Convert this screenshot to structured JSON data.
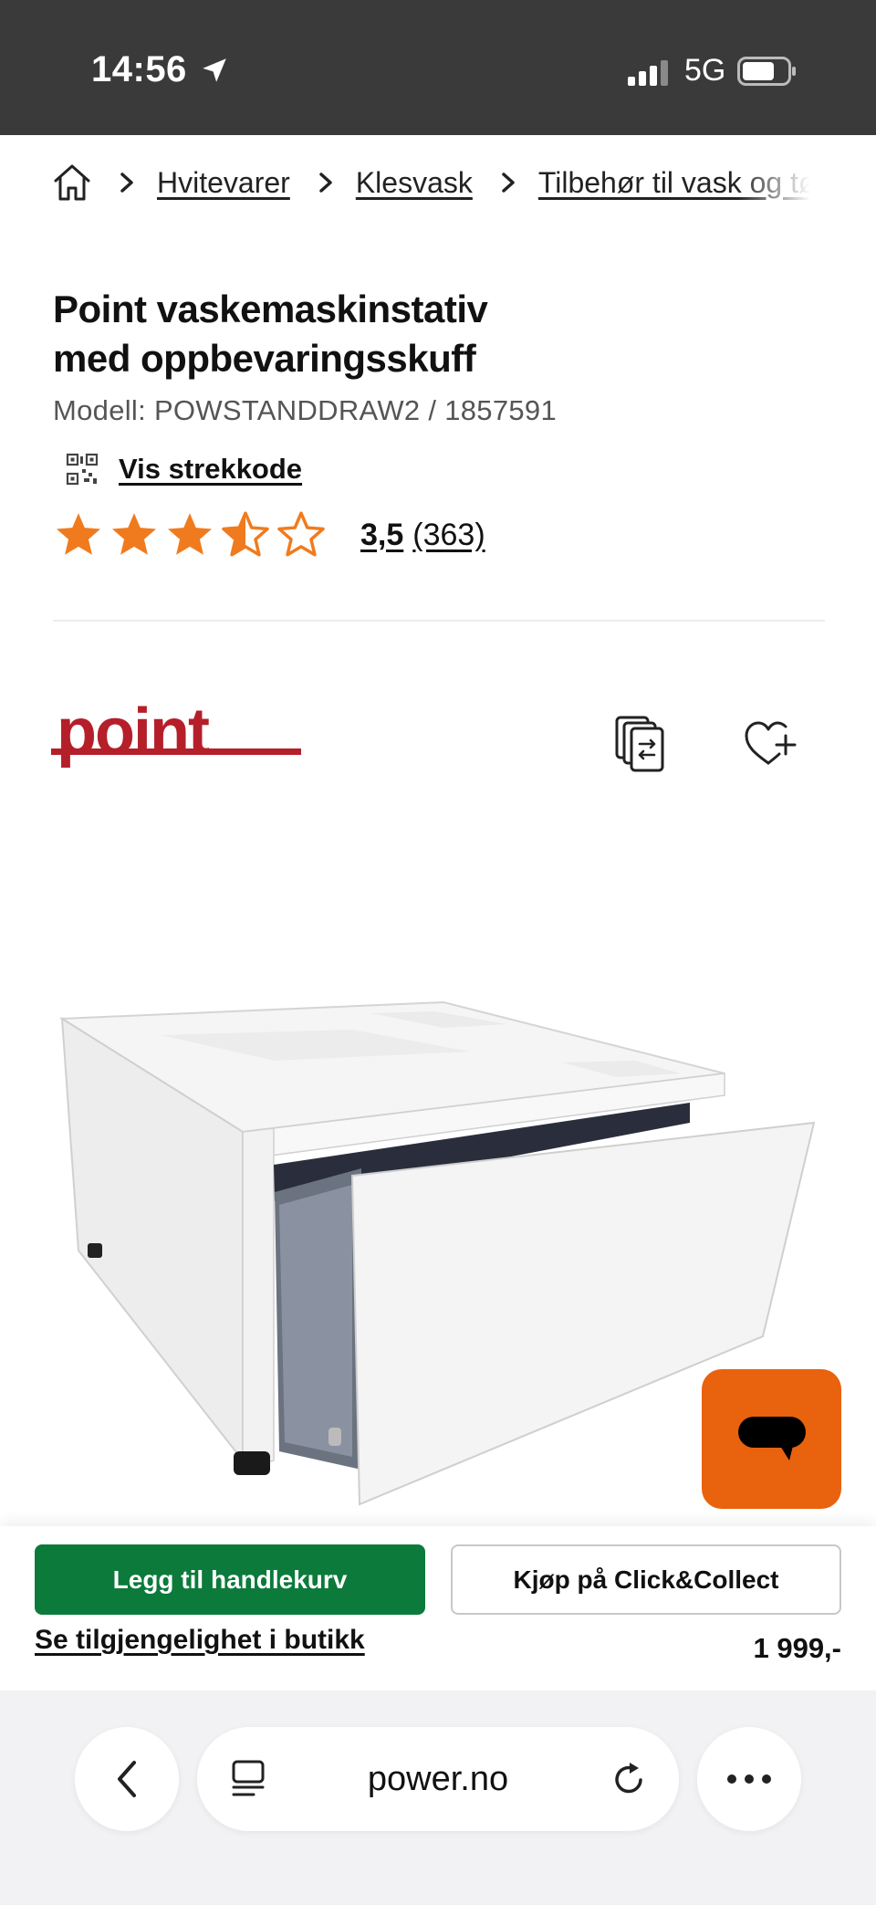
{
  "status_bar": {
    "time": "14:56",
    "network": "5G",
    "icons": [
      "location-arrow-icon",
      "signal-bars-icon",
      "battery-icon"
    ]
  },
  "breadcrumb": {
    "home_icon": "home-icon",
    "items": [
      "Hvitevarer",
      "Klesvask",
      "Tilbehør til vask og tørk"
    ]
  },
  "product": {
    "title_line1": "Point vaskemaskinstativ",
    "title_line2": "med oppbevaringsskuff",
    "model": "Modell: POWSTANDDRAW2 / 1857591",
    "barcode_label": "Vis strekkode",
    "rating_value": 3.5,
    "rating_label": "3,5",
    "review_count": "(363)",
    "brand": "point"
  },
  "actions": {
    "compare_icon": "compare-icon",
    "favorite_icon": "heart-plus-icon",
    "chat_icon": "chat-bubble-icon"
  },
  "purchase": {
    "add_to_cart": "Legg til handlekurv",
    "click_collect": "Kjøp på Click&Collect",
    "stock_link": "Se tilgjengelighet i butikk",
    "price": "1 999,-"
  },
  "browser": {
    "url": "power.no",
    "icons": [
      "back-chevron-icon",
      "tabs-icon",
      "reload-icon",
      "more-dots-icon"
    ]
  },
  "colors": {
    "accent_orange": "#e9620e",
    "cart_green": "#0b7a3b",
    "brand_red": "#b51f2a",
    "star_orange": "#f07b1e"
  }
}
